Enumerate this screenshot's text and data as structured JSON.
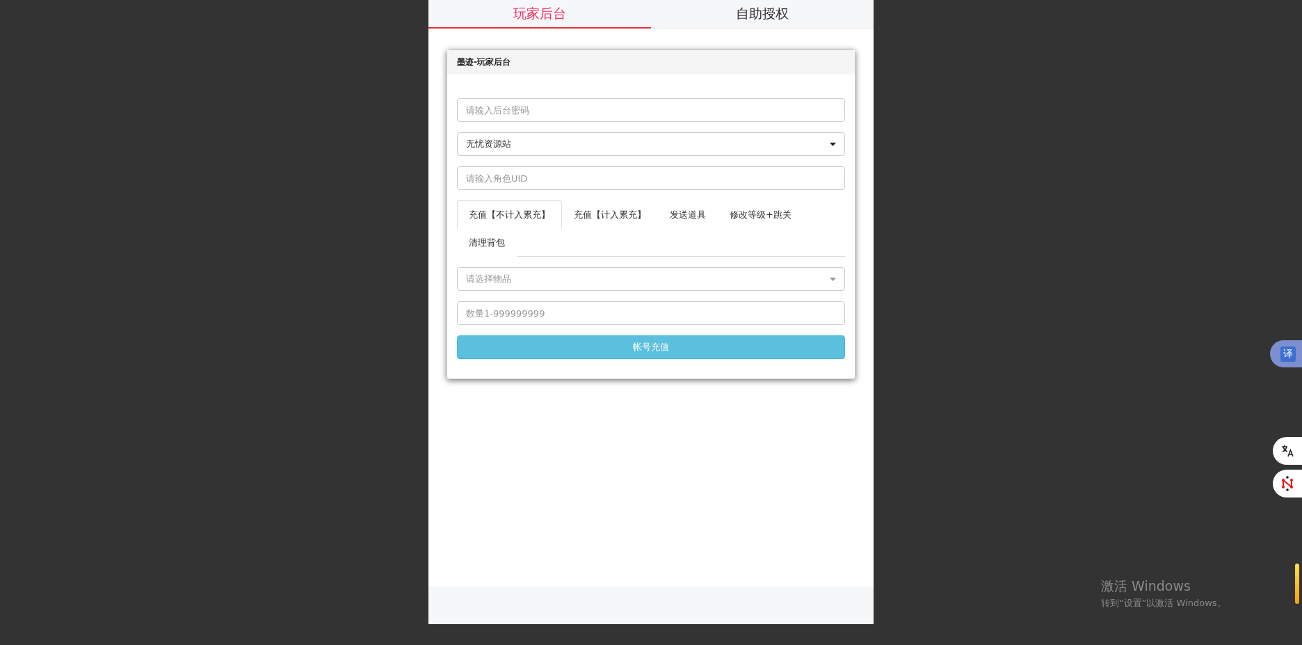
{
  "top_tabs": [
    {
      "label": "玩家后台",
      "selected": true
    },
    {
      "label": "自助授权",
      "selected": false
    }
  ],
  "card": {
    "title": "墨迹-玩家后台",
    "password_field": {
      "placeholder": "请输入后台密码"
    },
    "server_select": {
      "value": "无忧资源站"
    },
    "uid_field": {
      "placeholder": "请输入角色UID"
    },
    "tabs": [
      {
        "label": "充值【不计入累充】",
        "selected": true
      },
      {
        "label": "充值【计入累充】",
        "selected": false
      },
      {
        "label": "发送道具",
        "selected": false
      },
      {
        "label": "修改等级+跳关",
        "selected": false
      },
      {
        "label": "清理背包",
        "selected": false
      }
    ],
    "item_select": {
      "placeholder": "请选择物品"
    },
    "quantity_field": {
      "placeholder": "数量1-999999999"
    },
    "submit_button": "帐号充值"
  },
  "side_widgets": {
    "translate_badge": "译"
  },
  "activation_notice": {
    "title": "激活 Windows",
    "text": "转到“设置”以激活 Windows。"
  }
}
